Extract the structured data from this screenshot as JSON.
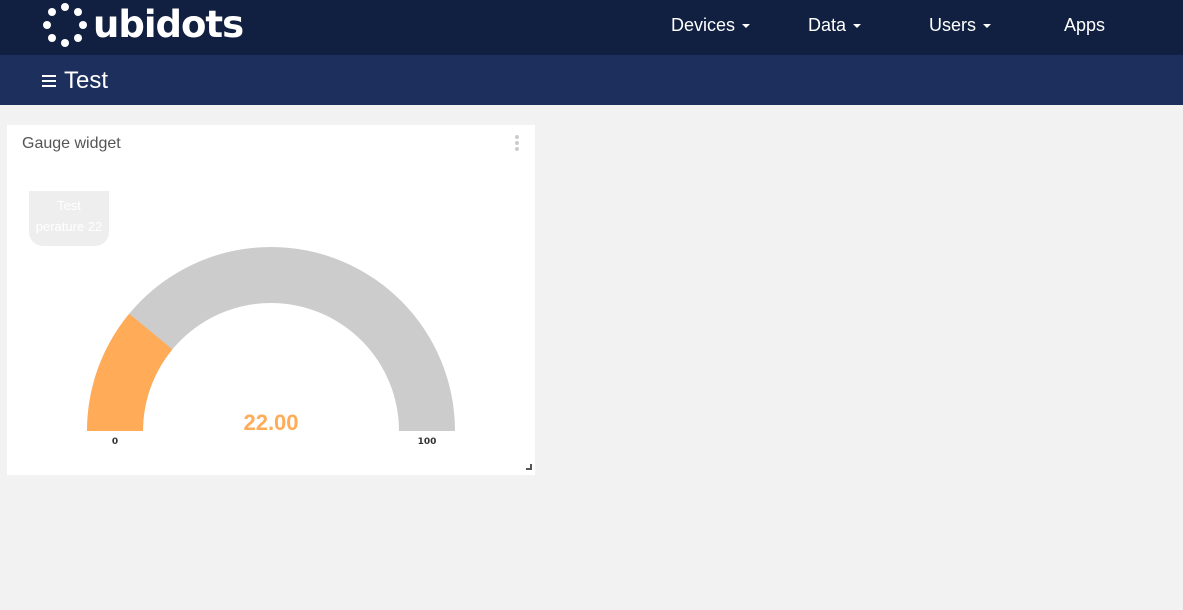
{
  "header": {
    "brand": "ubidots",
    "nav": [
      {
        "label": "Devices",
        "dropdown": true
      },
      {
        "label": "Data",
        "dropdown": true
      },
      {
        "label": "Users",
        "dropdown": true
      },
      {
        "label": "Apps",
        "dropdown": false
      }
    ]
  },
  "dashboard": {
    "title": "Test"
  },
  "widget": {
    "title": "Gauge widget",
    "tooltip_lines": [
      "Test",
      "perature 22"
    ],
    "gauge": {
      "value": 22,
      "value_label": "22.00",
      "min": 0,
      "max": 100,
      "min_label": "0",
      "max_label": "100",
      "fill_color": "#ffab57",
      "track_color": "#cccccc"
    }
  },
  "colors": {
    "topbar": "#112041",
    "subbar": "#1d2f5c",
    "background": "#f2f2f2"
  },
  "icons": [
    "ubidots-logo-icon",
    "caret-down-icon",
    "hamburger-menu-icon",
    "kebab-menu-icon",
    "resize-handle-icon"
  ]
}
